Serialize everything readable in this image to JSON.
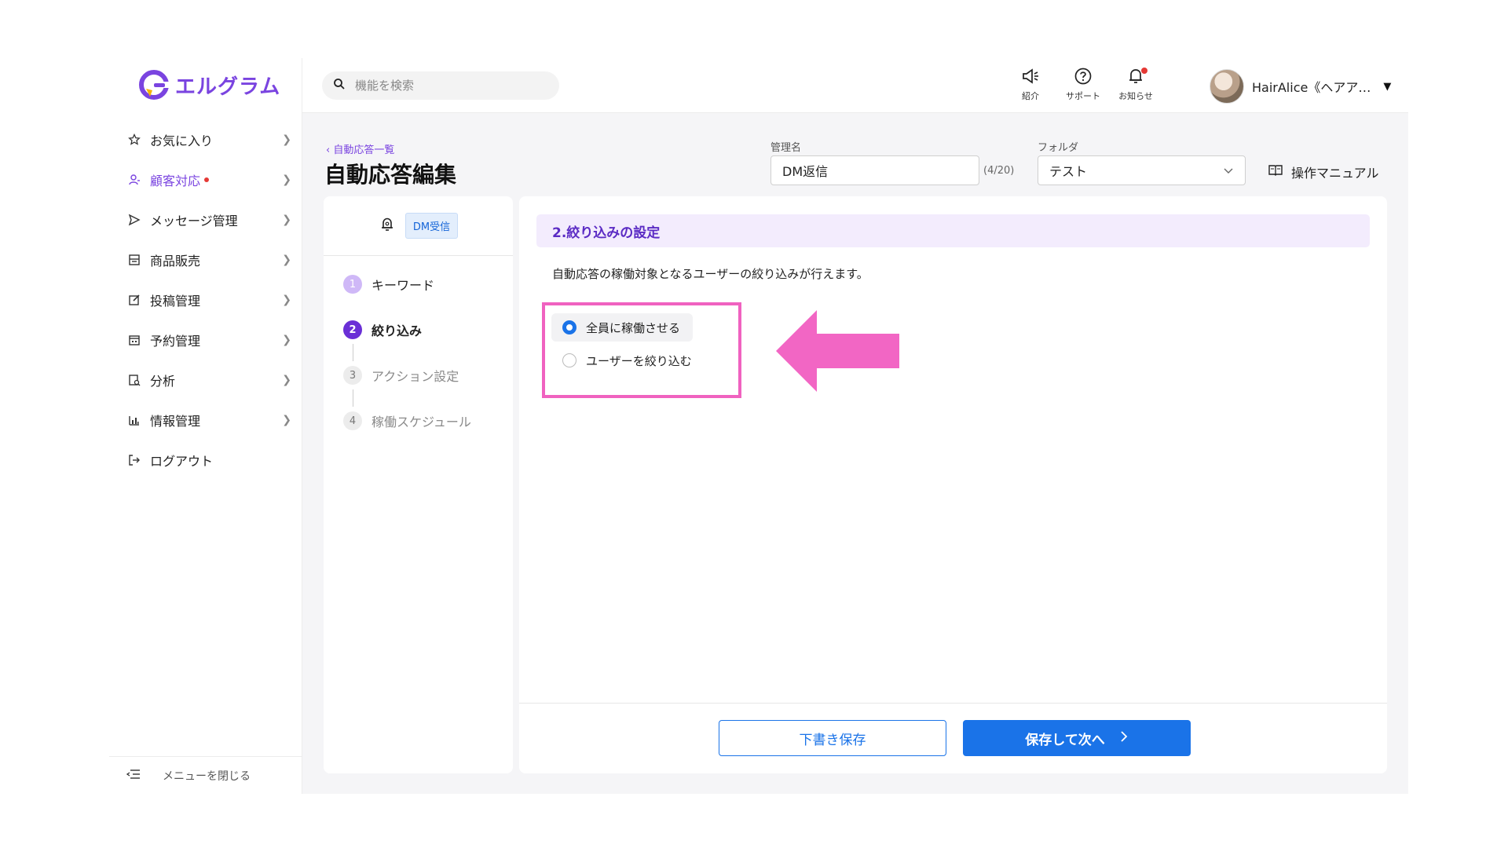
{
  "brand": {
    "name": "エルグラム",
    "color": "#7a44e0"
  },
  "sidebar": {
    "items": [
      {
        "label": "お気に入り",
        "icon": "star-icon"
      },
      {
        "label": "顧客対応",
        "icon": "person-icon",
        "active": true,
        "has_alert": true
      },
      {
        "label": "メッセージ管理",
        "icon": "send-icon"
      },
      {
        "label": "商品販売",
        "icon": "register-icon"
      },
      {
        "label": "投稿管理",
        "icon": "edit-icon"
      },
      {
        "label": "予約管理",
        "icon": "calendar-icon"
      },
      {
        "label": "分析",
        "icon": "report-icon"
      },
      {
        "label": "情報管理",
        "icon": "bar-chart-icon"
      },
      {
        "label": "ログアウト",
        "icon": "logout-icon"
      }
    ],
    "footer_label": "メニューを閉じる"
  },
  "topbar": {
    "search_placeholder": "機能を検索",
    "icons": [
      {
        "label": "紹介",
        "icon": "megaphone-icon"
      },
      {
        "label": "サポート",
        "icon": "help-icon"
      },
      {
        "label": "お知らせ",
        "icon": "bell-icon",
        "has_alert": true
      }
    ],
    "user_name": "HairAlice《ヘアア…"
  },
  "header": {
    "breadcrumb": "自動応答一覧",
    "title": "自動応答編集",
    "name_label": "管理名",
    "name_value": "DM返信",
    "name_counter": "(4/20)",
    "folder_label": "フォルダ",
    "folder_value": "テスト",
    "manual_label": "操作マニュアル"
  },
  "steps": {
    "trigger_badge": "DM受信",
    "items": [
      {
        "num": "1",
        "label": "キーワード",
        "state": "done"
      },
      {
        "num": "2",
        "label": "絞り込み",
        "state": "current"
      },
      {
        "num": "3",
        "label": "アクション設定",
        "state": "pending"
      },
      {
        "num": "4",
        "label": "稼働スケジュール",
        "state": "pending"
      }
    ]
  },
  "content": {
    "section_title": "2.絞り込みの設定",
    "description": "自動応答の稼働対象となるユーザーの絞り込みが行えます。",
    "options": [
      {
        "label": "全員に稼働させる",
        "selected": true
      },
      {
        "label": "ユーザーを絞り込む",
        "selected": false
      }
    ],
    "draft_button": "下書き保存",
    "next_button": "保存して次へ"
  },
  "colors": {
    "accent_purple": "#7a44e0",
    "primary_blue": "#1a73e8",
    "highlight_pink": "#f062c0"
  }
}
